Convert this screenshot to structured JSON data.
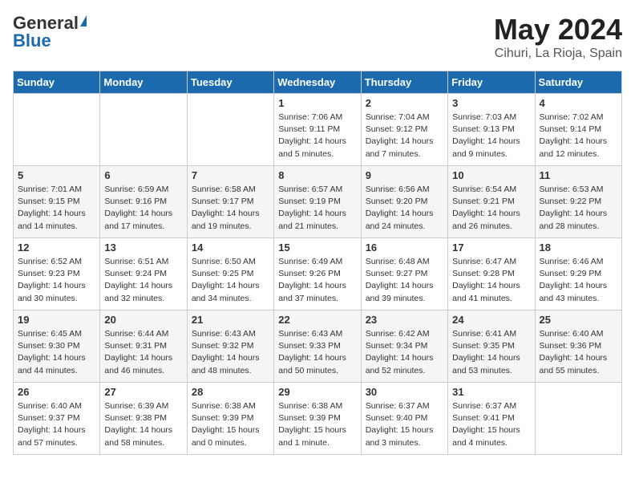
{
  "header": {
    "logo_general": "General",
    "logo_blue": "Blue",
    "title": "May 2024",
    "subtitle": "Cihuri, La Rioja, Spain"
  },
  "columns": [
    "Sunday",
    "Monday",
    "Tuesday",
    "Wednesday",
    "Thursday",
    "Friday",
    "Saturday"
  ],
  "weeks": [
    [
      {
        "day": "",
        "info": ""
      },
      {
        "day": "",
        "info": ""
      },
      {
        "day": "",
        "info": ""
      },
      {
        "day": "1",
        "info": "Sunrise: 7:06 AM\nSunset: 9:11 PM\nDaylight: 14 hours\nand 5 minutes."
      },
      {
        "day": "2",
        "info": "Sunrise: 7:04 AM\nSunset: 9:12 PM\nDaylight: 14 hours\nand 7 minutes."
      },
      {
        "day": "3",
        "info": "Sunrise: 7:03 AM\nSunset: 9:13 PM\nDaylight: 14 hours\nand 9 minutes."
      },
      {
        "day": "4",
        "info": "Sunrise: 7:02 AM\nSunset: 9:14 PM\nDaylight: 14 hours\nand 12 minutes."
      }
    ],
    [
      {
        "day": "5",
        "info": "Sunrise: 7:01 AM\nSunset: 9:15 PM\nDaylight: 14 hours\nand 14 minutes."
      },
      {
        "day": "6",
        "info": "Sunrise: 6:59 AM\nSunset: 9:16 PM\nDaylight: 14 hours\nand 17 minutes."
      },
      {
        "day": "7",
        "info": "Sunrise: 6:58 AM\nSunset: 9:17 PM\nDaylight: 14 hours\nand 19 minutes."
      },
      {
        "day": "8",
        "info": "Sunrise: 6:57 AM\nSunset: 9:19 PM\nDaylight: 14 hours\nand 21 minutes."
      },
      {
        "day": "9",
        "info": "Sunrise: 6:56 AM\nSunset: 9:20 PM\nDaylight: 14 hours\nand 24 minutes."
      },
      {
        "day": "10",
        "info": "Sunrise: 6:54 AM\nSunset: 9:21 PM\nDaylight: 14 hours\nand 26 minutes."
      },
      {
        "day": "11",
        "info": "Sunrise: 6:53 AM\nSunset: 9:22 PM\nDaylight: 14 hours\nand 28 minutes."
      }
    ],
    [
      {
        "day": "12",
        "info": "Sunrise: 6:52 AM\nSunset: 9:23 PM\nDaylight: 14 hours\nand 30 minutes."
      },
      {
        "day": "13",
        "info": "Sunrise: 6:51 AM\nSunset: 9:24 PM\nDaylight: 14 hours\nand 32 minutes."
      },
      {
        "day": "14",
        "info": "Sunrise: 6:50 AM\nSunset: 9:25 PM\nDaylight: 14 hours\nand 34 minutes."
      },
      {
        "day": "15",
        "info": "Sunrise: 6:49 AM\nSunset: 9:26 PM\nDaylight: 14 hours\nand 37 minutes."
      },
      {
        "day": "16",
        "info": "Sunrise: 6:48 AM\nSunset: 9:27 PM\nDaylight: 14 hours\nand 39 minutes."
      },
      {
        "day": "17",
        "info": "Sunrise: 6:47 AM\nSunset: 9:28 PM\nDaylight: 14 hours\nand 41 minutes."
      },
      {
        "day": "18",
        "info": "Sunrise: 6:46 AM\nSunset: 9:29 PM\nDaylight: 14 hours\nand 43 minutes."
      }
    ],
    [
      {
        "day": "19",
        "info": "Sunrise: 6:45 AM\nSunset: 9:30 PM\nDaylight: 14 hours\nand 44 minutes."
      },
      {
        "day": "20",
        "info": "Sunrise: 6:44 AM\nSunset: 9:31 PM\nDaylight: 14 hours\nand 46 minutes."
      },
      {
        "day": "21",
        "info": "Sunrise: 6:43 AM\nSunset: 9:32 PM\nDaylight: 14 hours\nand 48 minutes."
      },
      {
        "day": "22",
        "info": "Sunrise: 6:43 AM\nSunset: 9:33 PM\nDaylight: 14 hours\nand 50 minutes."
      },
      {
        "day": "23",
        "info": "Sunrise: 6:42 AM\nSunset: 9:34 PM\nDaylight: 14 hours\nand 52 minutes."
      },
      {
        "day": "24",
        "info": "Sunrise: 6:41 AM\nSunset: 9:35 PM\nDaylight: 14 hours\nand 53 minutes."
      },
      {
        "day": "25",
        "info": "Sunrise: 6:40 AM\nSunset: 9:36 PM\nDaylight: 14 hours\nand 55 minutes."
      }
    ],
    [
      {
        "day": "26",
        "info": "Sunrise: 6:40 AM\nSunset: 9:37 PM\nDaylight: 14 hours\nand 57 minutes."
      },
      {
        "day": "27",
        "info": "Sunrise: 6:39 AM\nSunset: 9:38 PM\nDaylight: 14 hours\nand 58 minutes."
      },
      {
        "day": "28",
        "info": "Sunrise: 6:38 AM\nSunset: 9:39 PM\nDaylight: 15 hours\nand 0 minutes."
      },
      {
        "day": "29",
        "info": "Sunrise: 6:38 AM\nSunset: 9:39 PM\nDaylight: 15 hours\nand 1 minute."
      },
      {
        "day": "30",
        "info": "Sunrise: 6:37 AM\nSunset: 9:40 PM\nDaylight: 15 hours\nand 3 minutes."
      },
      {
        "day": "31",
        "info": "Sunrise: 6:37 AM\nSunset: 9:41 PM\nDaylight: 15 hours\nand 4 minutes."
      },
      {
        "day": "",
        "info": ""
      }
    ]
  ]
}
